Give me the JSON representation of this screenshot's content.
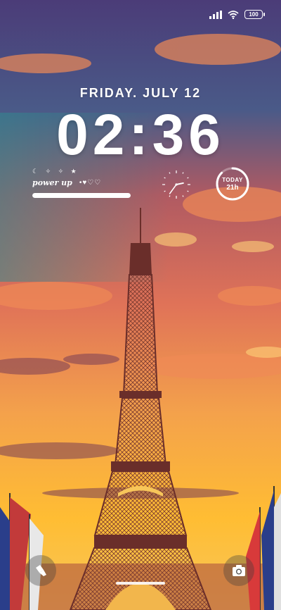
{
  "status": {
    "battery": "100"
  },
  "lockscreen": {
    "date": "FRIDAY. JULY 12",
    "time": "02:36"
  },
  "widget": {
    "stars": "☾ ✧ ✧ ★",
    "title": "power up",
    "hearts": "•♥♡♡",
    "progress": 1.0
  },
  "clock_widget": {
    "hour": 2,
    "minute": 36
  },
  "today_widget": {
    "label": "TODAY",
    "value": "21h",
    "fraction": 0.875
  },
  "shortcuts": {
    "left_icon": "flashlight-icon",
    "right_icon": "camera-icon"
  },
  "colors": {
    "sky_top": "#3a3f7a",
    "sky_mid": "#d9634d",
    "horizon": "#ffb632",
    "tower": "#5a2a2a"
  }
}
